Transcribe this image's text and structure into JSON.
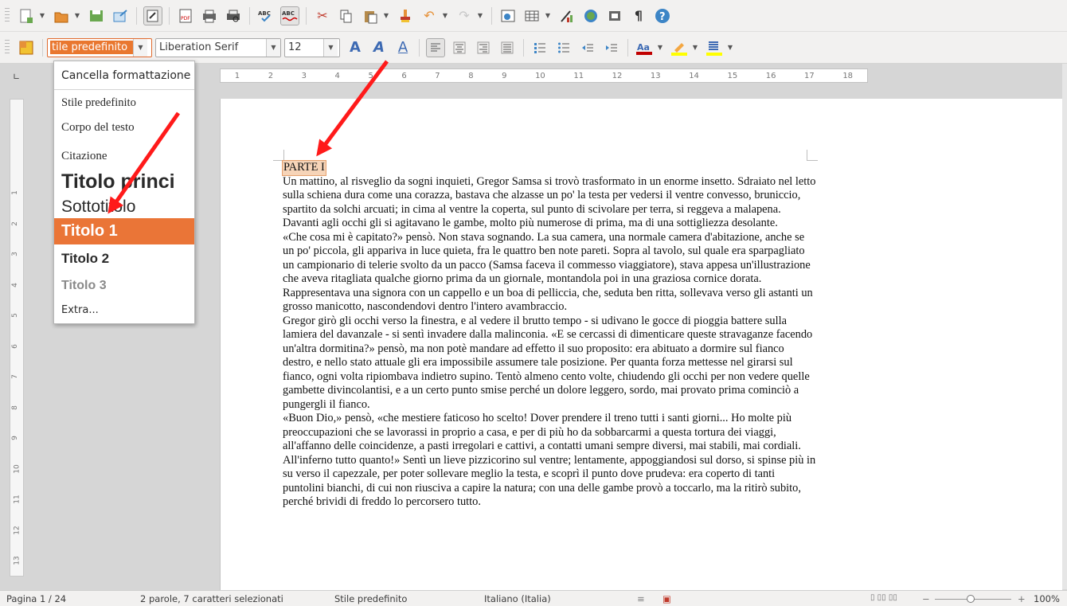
{
  "toolbar1": {
    "icons": [
      "new-document-icon",
      "open-folder-icon",
      "save-icon",
      "export-icon",
      "edit-mode-icon",
      "export-pdf-icon",
      "print-icon",
      "print-preview-icon",
      "spellcheck-icon",
      "autospellcheck-icon",
      "cut-icon",
      "copy-icon",
      "paste-icon",
      "clone-format-icon",
      "undo-icon",
      "redo-icon",
      "navigator-icon",
      "table-icon",
      "chart-icon",
      "gallery-icon",
      "data-sources-icon",
      "formatting-marks-icon",
      "help-icon"
    ]
  },
  "toolbar2": {
    "paragraph_style": "tile predefinito",
    "font_name": "Liberation Serif",
    "font_size": "12"
  },
  "style_menu": {
    "clear": "Cancella formattazione",
    "items": [
      "Stile predefinito",
      "Corpo del testo",
      "Citazione",
      "Titolo princi",
      "Sottotitolo",
      "Titolo 1",
      "Titolo 2",
      "Titolo 3"
    ],
    "extra": "Extra...",
    "highlighted": "Titolo 1"
  },
  "ruler": {
    "labels": [
      "1",
      "2",
      "3",
      "4",
      "5",
      "6",
      "7",
      "8",
      "9",
      "10",
      "11",
      "12",
      "13",
      "14",
      "15",
      "16",
      "17",
      "18"
    ]
  },
  "vruler": {
    "labels": [
      "1",
      "2",
      "3",
      "4",
      "5",
      "6",
      "7",
      "8",
      "9",
      "10",
      "11",
      "12",
      "13"
    ]
  },
  "document": {
    "heading": "PARTE I",
    "paragraphs": [
      "Un mattino, al risveglio da sogni inquieti, Gregor Samsa si trovò trasformato in un enorme insetto. Sdraiato nel letto sulla schiena dura come una corazza, bastava che alzasse un po' la testa per vedersi il ventre convesso, bruniccio, spartito da solchi arcuati; in cima al ventre la coperta, sul punto di scivolare per terra, si reggeva a malapena. Davanti agli occhi gli si agitavano le gambe, molto più numerose di prima, ma di una sottigliezza desolante.",
      "«Che cosa mi è capitato?» pensò. Non stava sognando. La sua camera, una normale camera d'abitazione, anche se un po' piccola, gli appariva in luce quieta, fra le quattro ben note pareti. Sopra al tavolo, sul quale era sparpagliato un campionario di telerie svolto da un pacco (Samsa faceva il commesso viaggiatore), stava appesa un'illustrazione che aveva ritagliata qualche giorno prima da un giornale, montandola poi in una graziosa cornice dorata. Rappresentava una signora con un cappello e un boa di pelliccia, che, seduta ben ritta, sollevava verso gli astanti un grosso manicotto, nascondendovi dentro l'intero avambraccio.",
      "Gregor girò gli occhi verso la finestra, e al vedere il brutto tempo - si udivano le gocce di pioggia battere sulla lamiera del davanzale - si sentì invadere dalla malinconia. «E se cercassi di dimenticare queste stravaganze facendo un'altra dormitina?» pensò, ma non potè mandare ad effetto il suo proposito: era abituato a dormire sul fianco destro, e nello stato attuale gli era impossibile assumere tale posizione. Per quanta forza mettesse nel girarsi sul fianco, ogni volta ripiombava indietro supino. Tentò almeno cento volte, chiudendo gli occhi per non vedere quelle gambette divincolantisi, e a un certo punto smise perché un dolore leggero, sordo, mai provato prima cominciò a pungergli il fianco.",
      "«Buon Dio,» pensò, «che mestiere faticoso ho scelto! Dover prendere il treno tutti i santi giorni... Ho molte più preoccupazioni che se lavorassi in proprio a casa, e per di più ho da sobbarcarmi a questa tortura dei viaggi, all'affanno delle coincidenze, a pasti irregolari e cattivi, a contatti umani sempre diversi, mai stabili, mai cordiali. All'inferno tutto quanto!» Sentì un lieve pizzicorino sul ventre; lentamente, appoggiandosi sul dorso, si spinse più in su verso il capezzale, per poter sollevare meglio la testa, e scoprì il punto dove prudeva: era coperto di tanti puntolini bianchi, di cui non riusciva a capire la natura; con una delle gambe provò a toccarlo, ma la ritirò subito, perché brividi di freddo lo percorsero tutto."
    ]
  },
  "statusbar": {
    "page": "Pagina 1 / 24",
    "selection": "2 parole, 7 caratteri selezionati",
    "style": "Stile predefinito",
    "language": "Italiano (Italia)",
    "zoom": "100%"
  },
  "colors": {
    "accent": "#ea7537",
    "annotation_arrow": "#ff1a1a"
  }
}
